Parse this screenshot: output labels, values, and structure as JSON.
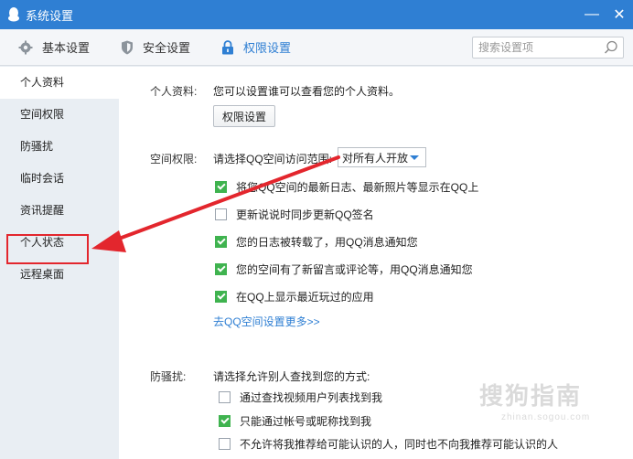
{
  "window": {
    "title": "系统设置",
    "minimize_glyph": "—",
    "close_glyph": "✕"
  },
  "toolbar": {
    "tabs": [
      {
        "label": "基本设置",
        "icon": "gear-icon"
      },
      {
        "label": "安全设置",
        "icon": "shield-icon"
      },
      {
        "label": "权限设置",
        "icon": "lock-icon",
        "active": true
      }
    ],
    "search_placeholder": "搜索设置项"
  },
  "sidebar": {
    "items": [
      {
        "label": "个人资料",
        "active": true
      },
      {
        "label": "空间权限"
      },
      {
        "label": "防骚扰"
      },
      {
        "label": "临时会话"
      },
      {
        "label": "资讯提醒"
      },
      {
        "label": "个人状态",
        "highlighted": true
      },
      {
        "label": "远程桌面"
      }
    ]
  },
  "content": {
    "profile": {
      "label": "个人资料:",
      "text": "您可以设置谁可以查看您的个人资料。",
      "button": "权限设置"
    },
    "space": {
      "label": "空间权限:",
      "text": "请选择QQ空间访问范围:",
      "dropdown_value": "对所有人开放",
      "options": [
        {
          "label": "将您QQ空间的最新日志、最新照片等显示在QQ上",
          "checked": true
        },
        {
          "label": "更新说说时同步更新QQ签名",
          "checked": false
        },
        {
          "label": "您的日志被转载了，用QQ消息通知您",
          "checked": true
        },
        {
          "label": "您的空间有了新留言或评论等，用QQ消息通知您",
          "checked": true
        },
        {
          "label": "在QQ上显示最近玩过的应用",
          "checked": true
        }
      ],
      "link": "去QQ空间设置更多>>"
    },
    "antispam": {
      "label": "防骚扰:",
      "text": "请选择允许别人查找到您的方式:",
      "options": [
        {
          "label": "通过查找视频用户列表找到我",
          "checked": false
        },
        {
          "label": "只能通过帐号或昵称找到我",
          "checked": true
        },
        {
          "label": "不允许将我推荐给可能认识的人，同时也不向我推荐可能认识的人",
          "checked": false
        }
      ]
    }
  },
  "watermark": {
    "text": "搜狗指南",
    "sub": "zhinan.sogou.com"
  },
  "colors": {
    "accent": "#2f7fd3",
    "check": "#3fb34f",
    "annotation": "#e3262d"
  }
}
